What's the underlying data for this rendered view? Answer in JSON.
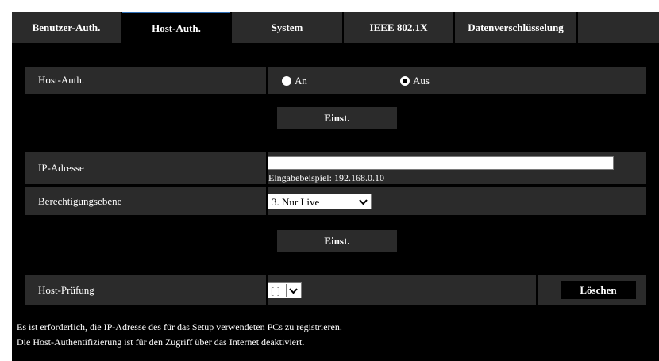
{
  "tabs": [
    {
      "label": "Benutzer-Auth.",
      "active": false
    },
    {
      "label": "Host-Auth.",
      "active": true
    },
    {
      "label": "System",
      "active": false
    },
    {
      "label": "IEEE 802.1X",
      "active": false
    },
    {
      "label": "Datenverschlüsselung",
      "active": false
    }
  ],
  "host_auth": {
    "label": "Host-Auth.",
    "option_on": "An",
    "option_off": "Aus",
    "selected": "Aus"
  },
  "set_button_1": "Einst.",
  "ip": {
    "label": "IP-Adresse",
    "value": "",
    "hint": "Eingabebeispiel: 192.168.0.10"
  },
  "level": {
    "label": "Berechtigungsebene",
    "value": "3. Nur Live"
  },
  "set_button_2": "Einst.",
  "host_check": {
    "label": "Host-Prüfung",
    "value": "[ ]",
    "delete_label": "Löschen"
  },
  "notes": [
    "Es ist erforderlich, die IP-Adresse des für das Setup verwendeten PCs zu registrieren.",
    "Die Host-Authentifizierung ist für den Zugriff über das Internet deaktiviert."
  ],
  "colors": {
    "accent_tab": "#2f6fb7",
    "panel": "#2b2b2b",
    "background": "#000000"
  }
}
